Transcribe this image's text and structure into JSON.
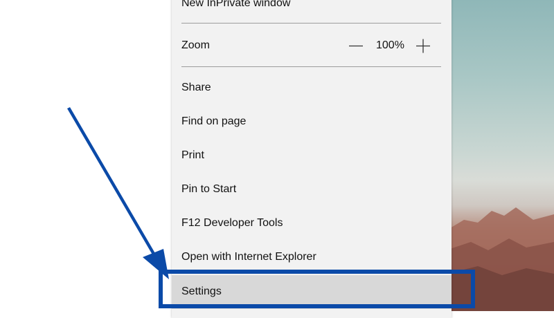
{
  "menu": {
    "items": [
      {
        "label": "New InPrivate window"
      },
      {
        "label": "Share"
      },
      {
        "label": "Find on page"
      },
      {
        "label": "Print"
      },
      {
        "label": "Pin to Start"
      },
      {
        "label": "F12 Developer Tools"
      },
      {
        "label": "Open with Internet Explorer"
      },
      {
        "label": "Settings"
      }
    ],
    "zoom": {
      "label": "Zoom",
      "value": "100%",
      "decrease_icon": "minus-icon",
      "increase_icon": "plus-icon"
    }
  },
  "annotation": {
    "color": "#0b4aa8",
    "arrow_icon": "arrow-pointer-icon",
    "highlight_target": "Settings"
  }
}
